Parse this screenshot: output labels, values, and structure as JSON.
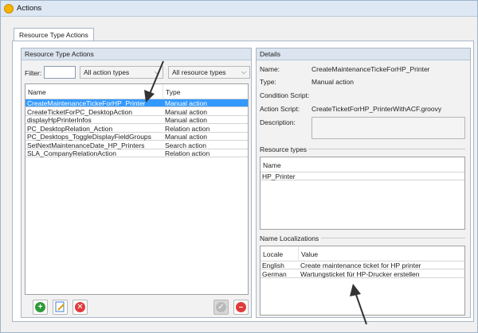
{
  "window": {
    "title": "Actions"
  },
  "tabs": [
    {
      "label": "Resource Type Actions"
    }
  ],
  "left_panel": {
    "header": "Resource Type Actions",
    "filter_label": "Filter:",
    "filter_value": "",
    "action_types_combo": "All action types",
    "resource_types_combo": "All resource types",
    "columns": [
      "Name",
      "Type"
    ],
    "rows": [
      {
        "name": "CreateMaintenanceTickeForHP_Printer",
        "type": "Manual action",
        "selected": true
      },
      {
        "name": "CreateTicketForPC_DesktopAction",
        "type": "Manual action"
      },
      {
        "name": "displayHpPrinterInfos",
        "type": "Manual action"
      },
      {
        "name": "PC_DesktopRelation_Action",
        "type": "Relation action"
      },
      {
        "name": "PC_Desktops_ToggleDisplayFieldGroups",
        "type": "Manual action"
      },
      {
        "name": "SetNextMaintenanceDate_HP_Printers",
        "type": "Search action"
      },
      {
        "name": "SLA_CompanyRelationAction",
        "type": "Relation action"
      }
    ]
  },
  "details": {
    "header": "Details",
    "name_label": "Name:",
    "name_value": "CreateMaintenanceTickeForHP_Printer",
    "type_label": "Type:",
    "type_value": "Manual action",
    "condition_label": "Condition Script:",
    "action_script_label": "Action Script:",
    "action_script_value": "CreateTicketForHP_PrinterWithACF.groovy",
    "description_label": "Description:",
    "resource_types": {
      "title": "Resource types",
      "columns": [
        "Name"
      ],
      "rows": [
        "HP_Printer"
      ]
    },
    "localizations": {
      "title": "Name Localizations",
      "columns": [
        "Locale",
        "Value"
      ],
      "rows": [
        {
          "locale": "English",
          "value": "Create maintenance ticket for HP printer"
        },
        {
          "locale": "German",
          "value": "Wartungsticket für HP-Drucker erstellen"
        }
      ]
    }
  },
  "icons": {
    "add": "plus-circle-icon",
    "edit": "edit-icon",
    "delete": "delete-circle-icon",
    "disabled_check": "check-circle-icon",
    "remove": "minus-circle-icon",
    "arrow": "annotation-arrow-icon"
  },
  "colors": {
    "selection": "#3399ff",
    "add": "#2e9b3a",
    "delete": "#e03a3a",
    "panel_header": "#dbe4ef"
  }
}
